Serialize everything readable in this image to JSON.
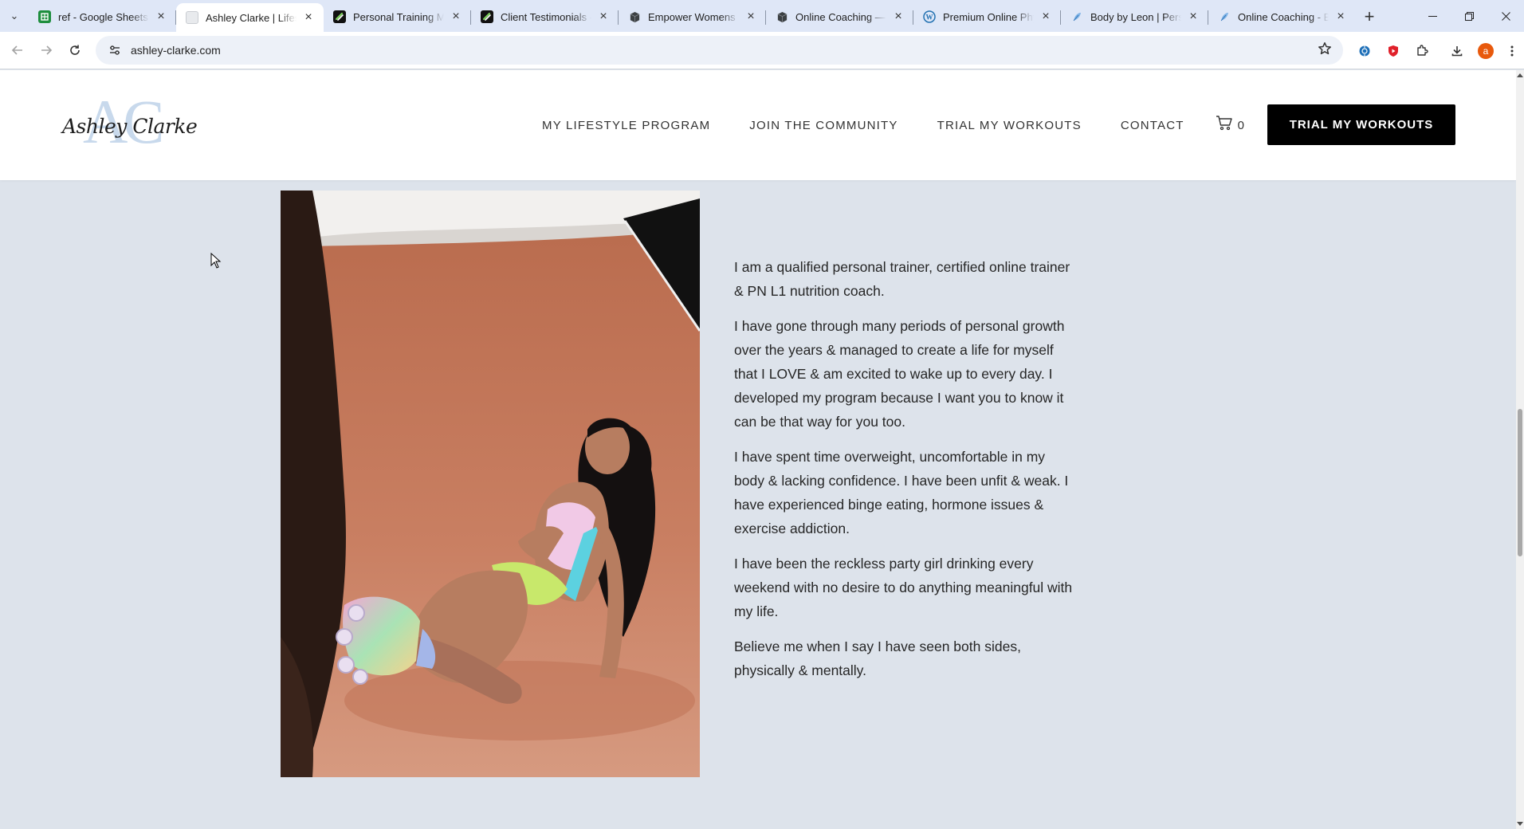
{
  "browser": {
    "tabs": [
      {
        "title": "ref - Google Sheets",
        "icon": "sheets-icon",
        "color": "#1e8e3e",
        "active": false
      },
      {
        "title": "Ashley Clarke | Lifestyle",
        "icon": "blank-page-icon",
        "color": "#e8eaed",
        "active": true
      },
      {
        "title": "Personal Training Mel",
        "icon": "squarespace-icon",
        "color": "#111111",
        "active": false
      },
      {
        "title": "Client Testimonials - F",
        "icon": "squarespace-icon",
        "color": "#111111",
        "active": false
      },
      {
        "title": "Empower Womens Fi",
        "icon": "cube-icon",
        "color": "#3c4043",
        "active": false
      },
      {
        "title": "Online Coaching — E",
        "icon": "cube-icon",
        "color": "#3c4043",
        "active": false
      },
      {
        "title": "Premium Online Phys",
        "icon": "wordpress-icon",
        "color": "#2271b1",
        "active": false
      },
      {
        "title": "Body by Leon | Perso",
        "icon": "feather-icon",
        "color": "#4a90d9",
        "active": false
      },
      {
        "title": "Online Coaching - Bo",
        "icon": "feather-icon",
        "color": "#4a90d9",
        "active": false
      }
    ],
    "url": "ashley-clarke.com",
    "profile_initial": "a"
  },
  "site": {
    "logo_monogram": "AC",
    "logo_script": "Ashley Clarke",
    "nav": [
      "MY LIFESTYLE PROGRAM",
      "JOIN THE COMMUNITY",
      "TRIAL MY WORKOUTS",
      "CONTACT"
    ],
    "cart_count": "0",
    "cta_label": "TRIAL MY WORKOUTS",
    "bio_paragraphs": [
      "I am a qualified personal trainer, certified online trainer & PN L1 nutrition coach.",
      "I have gone through many periods of personal growth over the years & managed to create a life for myself that I LOVE & am excited to wake up to every day. I developed my program because I want you to know it can be that way for you too.",
      "I have spent time overweight, uncomfortable in my body & lacking confidence. I have been unfit & weak. I have experienced binge eating, hormone issues & exercise addiction.",
      "I have been the reckless party girl drinking every weekend with no desire to do anything meaningful with my life.",
      "Believe me when I say I have seen both sides, physically & mentally."
    ],
    "colors": {
      "page_bg": "#dde3eb",
      "header_bg": "#ffffff",
      "cta_bg": "#000000",
      "photo_backdrop": "#c67a5c"
    }
  }
}
